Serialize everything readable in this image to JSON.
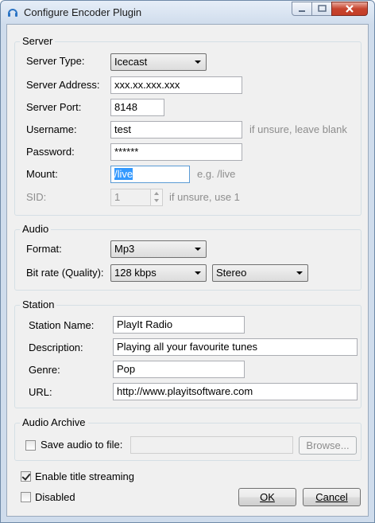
{
  "window": {
    "title": "Configure Encoder Plugin",
    "icon": "headphones-icon",
    "caption_buttons": [
      "minimize",
      "maximize",
      "close"
    ]
  },
  "server": {
    "group_title": "Server",
    "server_type_label": "Server Type:",
    "server_type_value": "Icecast",
    "server_address_label": "Server Address:",
    "server_address_value": "xxx.xx.xxx.xxx",
    "server_port_label": "Server Port:",
    "server_port_value": "8148",
    "username_label": "Username:",
    "username_value": "test",
    "username_hint": "if unsure, leave blank",
    "password_label": "Password:",
    "password_value": "******",
    "mount_label": "Mount:",
    "mount_value": "/live",
    "mount_hint": "e.g. /live",
    "sid_label": "SID:",
    "sid_value": "1",
    "sid_hint": "if unsure, use 1"
  },
  "audio": {
    "group_title": "Audio",
    "format_label": "Format:",
    "format_value": "Mp3",
    "bitrate_label": "Bit rate (Quality):",
    "bitrate_value": "128 kbps",
    "channels_value": "Stereo"
  },
  "station": {
    "group_title": "Station",
    "name_label": "Station Name:",
    "name_value": "PlayIt Radio",
    "description_label": "Description:",
    "description_value": "Playing all your favourite tunes",
    "genre_label": "Genre:",
    "genre_value": "Pop",
    "url_label": "URL:",
    "url_value": "http://www.playitsoftware.com"
  },
  "archive": {
    "group_title": "Audio Archive",
    "save_label": "Save audio to file:",
    "save_checked": false,
    "path_value": "",
    "browse_label": "Browse..."
  },
  "options": {
    "title_streaming_label": "Enable title streaming",
    "title_streaming_checked": true,
    "disabled_label": "Disabled",
    "disabled_checked": false
  },
  "buttons": {
    "ok_label": "OK",
    "cancel_label": "Cancel"
  }
}
